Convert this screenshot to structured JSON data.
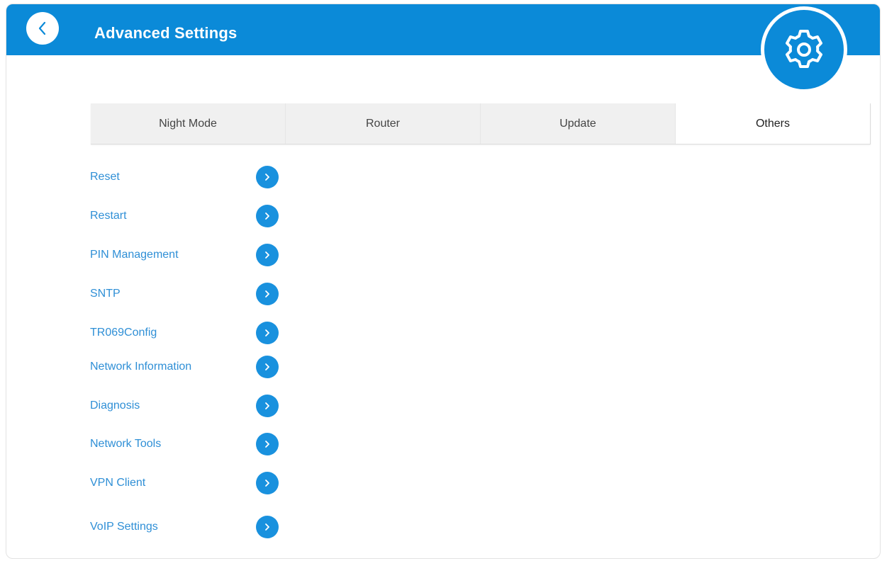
{
  "header": {
    "title": "Advanced Settings",
    "back_icon": "chevron-left-icon",
    "settings_icon": "gear-icon"
  },
  "colors": {
    "accent": "#0b8ad8",
    "link": "#2f8fd6",
    "tab_bg": "#f0f0f0",
    "tab_active_bg": "#ffffff"
  },
  "tabs": [
    {
      "label": "Night Mode",
      "active": false
    },
    {
      "label": "Router",
      "active": false
    },
    {
      "label": "Update",
      "active": false
    },
    {
      "label": "Others",
      "active": true
    }
  ],
  "menu": {
    "arrow_icon": "chevron-right-icon",
    "items": [
      {
        "label": "Reset"
      },
      {
        "label": "Restart"
      },
      {
        "label": "PIN Management"
      },
      {
        "label": "SNTP"
      },
      {
        "label": "TR069Config"
      },
      {
        "label": "Network Information"
      },
      {
        "label": "Diagnosis"
      },
      {
        "label": "Network Tools"
      },
      {
        "label": "VPN Client"
      },
      {
        "label": "VoIP Settings"
      }
    ]
  }
}
